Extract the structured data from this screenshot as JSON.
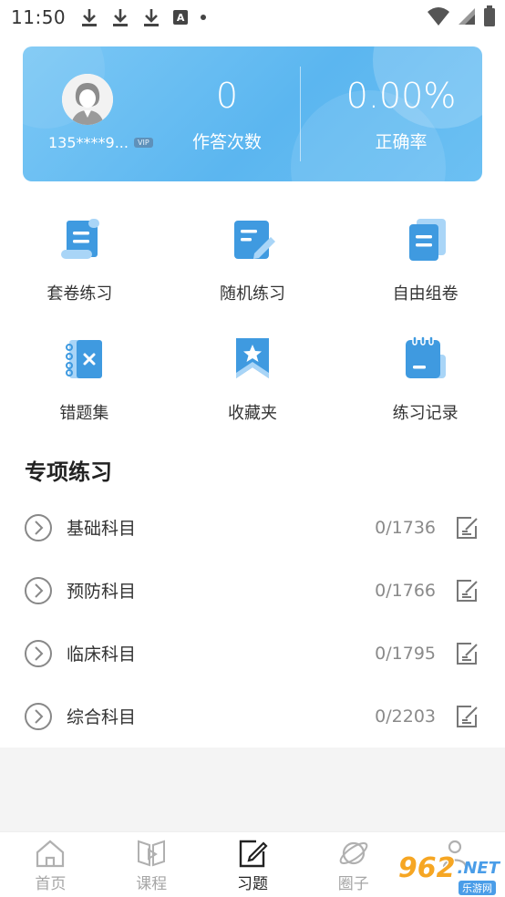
{
  "status_bar": {
    "time": "11:50",
    "a_icon_letter": "A",
    "icons": [
      "download-icon",
      "download-icon",
      "download-icon",
      "a-icon",
      "dot-icon",
      "wifi-icon",
      "signal-icon",
      "battery-icon"
    ]
  },
  "profile": {
    "username": "135****9...",
    "vip_label": "VIP",
    "answer_count": "0",
    "answer_count_label": "作答次数",
    "accuracy": "0.00%",
    "accuracy_label": "正确率",
    "card_color": "#62b9f2"
  },
  "grid": {
    "items": [
      {
        "label": "套卷练习",
        "icon": "scroll-doc-icon"
      },
      {
        "label": "随机练习",
        "icon": "edit-doc-icon"
      },
      {
        "label": "自由组卷",
        "icon": "stacked-doc-icon"
      },
      {
        "label": "错题集",
        "icon": "wrong-notebook-icon"
      },
      {
        "label": "收藏夹",
        "icon": "bookmark-star-icon"
      },
      {
        "label": "练习记录",
        "icon": "record-notebook-icon"
      }
    ],
    "icon_color": "#3f9ae0",
    "icon_light_color": "#a9d5f7"
  },
  "section": {
    "title": "专项练习",
    "subjects": [
      {
        "name": "基础科目",
        "progress": "0/1736"
      },
      {
        "name": "预防科目",
        "progress": "0/1766"
      },
      {
        "name": "临床科目",
        "progress": "0/1795"
      },
      {
        "name": "综合科目",
        "progress": "0/2203"
      }
    ]
  },
  "bottom_nav": {
    "items": [
      {
        "label": "首页",
        "icon": "home-icon"
      },
      {
        "label": "课程",
        "icon": "course-play-icon"
      },
      {
        "label": "习题",
        "icon": "exercise-edit-icon",
        "active": true
      },
      {
        "label": "圈子",
        "icon": "planet-icon"
      },
      {
        "label": "",
        "icon": "user-icon"
      }
    ]
  },
  "watermark": {
    "number": "962",
    "dot_net": ".NET",
    "subtitle": "乐游网"
  }
}
